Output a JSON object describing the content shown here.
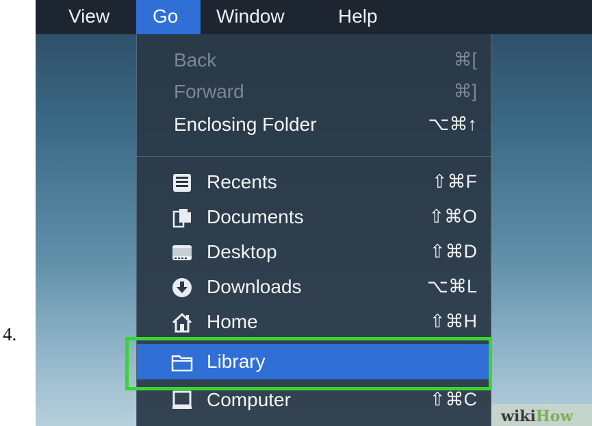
{
  "step_number": "4.",
  "menubar": {
    "items": [
      {
        "label": "View",
        "active": false
      },
      {
        "label": "Go",
        "active": true
      },
      {
        "label": "Window",
        "active": false
      },
      {
        "label": "Help",
        "active": false
      }
    ]
  },
  "go_menu": {
    "items": [
      {
        "label": "Back",
        "shortcut": "⌘[",
        "enabled": false
      },
      {
        "label": "Forward",
        "shortcut": "⌘]",
        "enabled": false
      },
      {
        "label": "Enclosing Folder",
        "shortcut": "⌥⌘↑",
        "enabled": true
      },
      {
        "label": "Recents",
        "shortcut": "⇧⌘F",
        "icon": "recents-icon",
        "enabled": true
      },
      {
        "label": "Documents",
        "shortcut": "⇧⌘O",
        "icon": "documents-icon",
        "enabled": true
      },
      {
        "label": "Desktop",
        "shortcut": "⇧⌘D",
        "icon": "desktop-icon",
        "enabled": true
      },
      {
        "label": "Downloads",
        "shortcut": "⌥⌘L",
        "icon": "downloads-icon",
        "enabled": true
      },
      {
        "label": "Home",
        "shortcut": "⇧⌘H",
        "icon": "home-icon",
        "enabled": true
      },
      {
        "label": "Library",
        "shortcut": "",
        "icon": "folder-icon",
        "enabled": true,
        "highlighted": true
      },
      {
        "label": "Computer",
        "shortcut": "⇧⌘C",
        "icon": "computer-icon",
        "enabled": true
      }
    ]
  },
  "watermark": {
    "part1": "wiki",
    "part2": "How"
  },
  "colors": {
    "highlight": "#2f6fd6",
    "callout_box": "#39d631",
    "menubar": "#1c2530",
    "menu_background": "#2a3846"
  }
}
